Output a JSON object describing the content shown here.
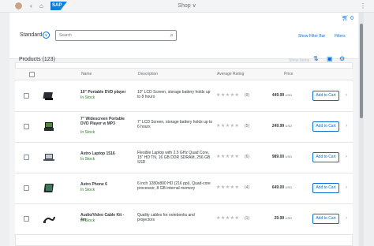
{
  "shell": {
    "logo": "SAP",
    "title": "Shop",
    "title_chevron": "∨",
    "back_icon": "back-arrow-icon",
    "forward_icon": "forward-arrow-icon"
  },
  "cart": {
    "count": "0"
  },
  "filter": {
    "variant": "Standard",
    "search_placeholder": "Search",
    "show_filter_bar": "Show Filter Bar",
    "filters": "Filters"
  },
  "table": {
    "title": "Products (123)",
    "show_items": "Show Items",
    "columns": {
      "name": "Name",
      "description": "Description",
      "rating": "Average Rating",
      "price": "Price"
    },
    "add_label": "Add to Cart",
    "currency": "USD",
    "rows": [
      {
        "name": "10\" Portable DVD player",
        "status": "In Stock",
        "description": "10\" LCD Screen, storage battery holds up to 8 hours",
        "rating_count": "(9)",
        "price": "449.99"
      },
      {
        "name": "7\" Widescreen Portable DVD Player w MP3",
        "status": "In Stock",
        "description": "7\" LCD Screen, storage battery holds up to 6 hours",
        "rating_count": "(5)",
        "price": "249.99"
      },
      {
        "name": "Astro Laptop 1516",
        "status": "In Stock",
        "description": "Flexible Laptop with 2.5 GHz Quad Core, 15\" HD TN, 16 GB DDR SDRAM, 256 GB SSD",
        "rating_count": "(6)",
        "price": "989.00"
      },
      {
        "name": "Astro Phone 6",
        "status": "In Stock",
        "description": "6 inch 1280x800 HD (216 ppi), Quad-core processor, 8 GB internal memory",
        "rating_count": "(4)",
        "price": "649.00"
      },
      {
        "name": "Audio/Video Cable Kit - 4m",
        "status": "In Stock",
        "description": "Quality cables for notebooks and projectors",
        "rating_count": "(1)",
        "price": "29.99"
      }
    ]
  },
  "colors": {
    "accent": "#0a6ed1",
    "success": "#2b7d2b"
  }
}
